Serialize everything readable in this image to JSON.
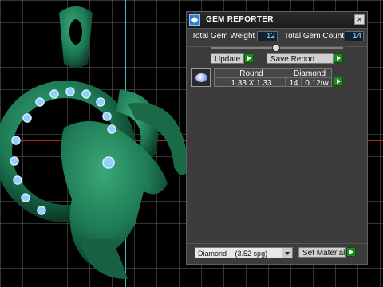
{
  "panel": {
    "title": "GEM REPORTER",
    "total_gem_weight_label": "Total Gem Weight",
    "total_gem_weight_value": "12",
    "total_gem_count_label": "Total Gem Count",
    "total_gem_count_value": "14",
    "update_label": "Update",
    "save_report_label": "Save Report",
    "table": {
      "headers": [
        "Round",
        "Diamond"
      ],
      "row": {
        "size": "1.33 X 1.33",
        "count": "14",
        "weight": "0.12tw"
      }
    },
    "material_select": {
      "value": "Diamond",
      "detail": "(3.52 spg)"
    },
    "set_material_label": "Set Material"
  },
  "colors": {
    "play_button": "#1c8c1c",
    "value_text": "#8ee8ff",
    "gem": "#8fd0ff",
    "model": "#1e7a55"
  },
  "icons": [
    "app-icon",
    "close-icon",
    "play-icon",
    "gem-thumbnail-icon",
    "chevron-down-icon"
  ]
}
